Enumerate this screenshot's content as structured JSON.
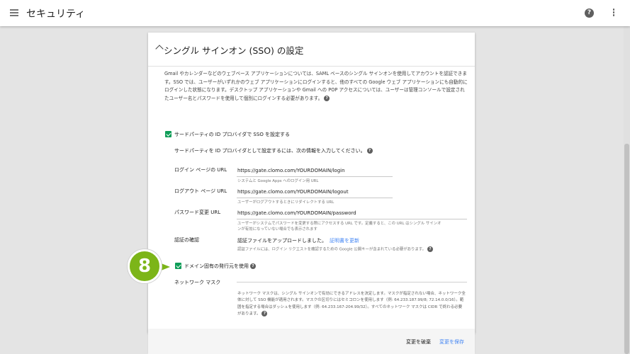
{
  "app": {
    "title": "セキュリティ"
  },
  "card": {
    "title": "シングル サインオン (SSO) の設定",
    "description": "Gmail やカレンダーなどのウェブベース アプリケーションについては、SAML ベースのシングル サインオンを使用してアカウントを認証できます。SSO では、ユーザーがいずれかのウェブ アプリケーションにログインすると、他のすべての Google ウェブ アプリケーションにも自動的にログインした状態になります。デスクトップ アプリケーションや Gmail への POP アクセスについては、ユーザーは管理コンソールで設定されたユーザー名とパスワードを使用して個別にログインする必要があります。"
  },
  "sso": {
    "checkbox_label": "サードパーティの ID プロバイダで SSO を設定する",
    "checked": true,
    "instructions": "サードパーティを ID プロバイダとして設定するには、次の情報を入力してください。",
    "fields": [
      {
        "label": "ログイン ページの URL",
        "value": "https://gate.clomo.com/YOURDOMAIN/login",
        "hint": "システムと Google Apps へのログイン用 URL"
      },
      {
        "label": "ログアウト ページ URL",
        "value": "https://gate.clomo.com/YOURDOMAIN/logout",
        "hint": "ユーザーがログアウトするときにリダイレクトする URL"
      },
      {
        "label": "パスワード変更 URL",
        "value": "https://gate.clomo.com/YOURDOMAIN/password",
        "hint_line1": "ユーザーがシステムでパスワードを変更する際にアクセスする URL です。定義すると、この URL はシングル サインオ",
        "hint_line2": "ンが有効になっていない場合でも表示されます"
      }
    ],
    "certificate": {
      "label": "認証の確認",
      "value": "認証ファイルをアップロードしました。",
      "link": "証明書を更新",
      "hint": "認証ファイルには、ログイン リクエストを確認するための Google 公開キーが含まれている必要があります。"
    },
    "domain_issuer": {
      "label": "ドメイン固有の発行元を使用",
      "checked": true
    },
    "network_mask": {
      "label": "ネットワーク マスク",
      "description": "ネットワーク マスクは、シングル サインオンで有効にできるアドレスを決定します。マスクが指定されない場合、ネットワーク全体に対して SSO 機能が適用されます。マスクの区切りにはセミコロンを使用します（例: 64.233.187.99/8; 72.14.0.0/16）。範囲を指定する場合はダッシュを使用します（例: 64.233.167-204.99/32）。すべてのネットワーク マスクは CIDR で終わる必要があります。"
    }
  },
  "footer": {
    "discard_label": "変更を破棄",
    "save_label": "変更を保存"
  },
  "annotation": {
    "step_number": "8",
    "color": "#7cb518"
  },
  "colors": {
    "accent": "#4285f4",
    "checkbox": "#0f9d58",
    "background": "#e4e4e4"
  },
  "icons": {
    "menu": "menu-icon",
    "help": "help-icon",
    "more": "more-vert-icon",
    "collapse": "chevron-up-icon"
  }
}
